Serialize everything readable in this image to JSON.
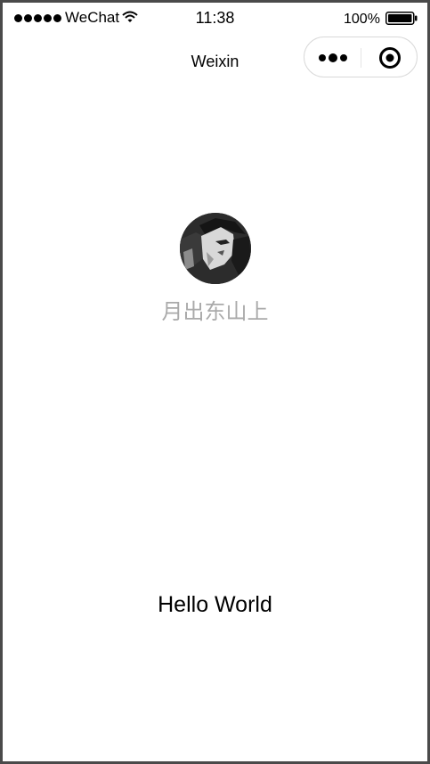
{
  "status_bar": {
    "carrier": "WeChat",
    "time": "11:38",
    "battery": "100%",
    "signal_icon": "signal-dots-icon",
    "wifi_icon": "wifi-icon",
    "battery_icon": "battery-icon"
  },
  "nav": {
    "title": "Weixin",
    "menu_icon": "more-dots-icon",
    "close_icon": "target-circle-icon"
  },
  "user": {
    "nickname": "月出东山上",
    "avatar_icon": "avatar-image"
  },
  "content": {
    "motto": "Hello World"
  },
  "colors": {
    "nickname": "#aaaaaa",
    "frame": "#4a4a4a",
    "text": "#000000"
  }
}
